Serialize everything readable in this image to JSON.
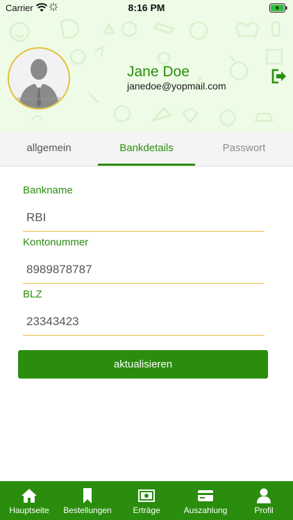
{
  "status_bar": {
    "carrier": "Carrier",
    "time": "8:16 PM"
  },
  "profile": {
    "name": "Jane Doe",
    "email": "janedoe@yopmail.com",
    "avatar_caption": "IMAGE AVAILABLE"
  },
  "tabs": [
    {
      "label": "allgemein",
      "selected": false
    },
    {
      "label": "Bankdetails",
      "selected": true
    },
    {
      "label": "Passwort",
      "selected": false
    }
  ],
  "form": {
    "bank_name": {
      "label": "Bankname",
      "value": "RBI"
    },
    "account_number": {
      "label": "Kontonummer",
      "value": "8989878787"
    },
    "blz": {
      "label": "BLZ",
      "value": "23343423"
    },
    "submit_label": "aktualisieren"
  },
  "bottom_nav": [
    {
      "label": "Hauptseite",
      "icon": "home-icon"
    },
    {
      "label": "Bestellungen",
      "icon": "bookmark-icon"
    },
    {
      "label": "Erträge",
      "icon": "money-icon"
    },
    {
      "label": "Auszahlung",
      "icon": "card-icon"
    },
    {
      "label": "Profil",
      "icon": "person-icon"
    }
  ],
  "colors": {
    "primary": "#2a8d0d",
    "header_bg": "#eefbe6",
    "accent_line": "#e2c13a"
  }
}
